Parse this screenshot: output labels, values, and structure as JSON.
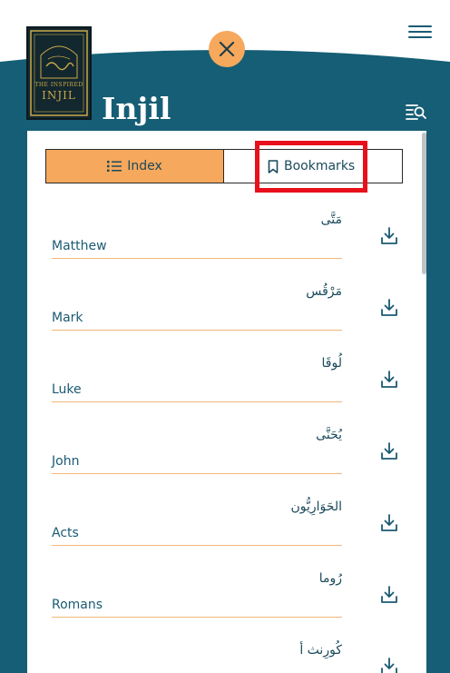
{
  "app": {
    "title": "Injil",
    "book_cover_line1": "THE INSPIRED",
    "book_cover_line2": "INJIL"
  },
  "tabs": {
    "index_label": "Index",
    "bookmarks_label": "Bookmarks",
    "active": "Index"
  },
  "colors": {
    "teal": "#155e75",
    "accent": "#f6a85c",
    "highlight": "#e8101a"
  },
  "books": [
    {
      "arabic": "مَتَّى",
      "english": "Matthew"
    },
    {
      "arabic": "مَرْقُس",
      "english": "Mark"
    },
    {
      "arabic": "لُوقَا",
      "english": "Luke"
    },
    {
      "arabic": "يُحَنَّى",
      "english": "John"
    },
    {
      "arabic": "الحَوَارِيُّون",
      "english": "Acts"
    },
    {
      "arabic": "رُوما",
      "english": "Romans"
    },
    {
      "arabic": "كُورِنث أ",
      "english": ""
    }
  ]
}
